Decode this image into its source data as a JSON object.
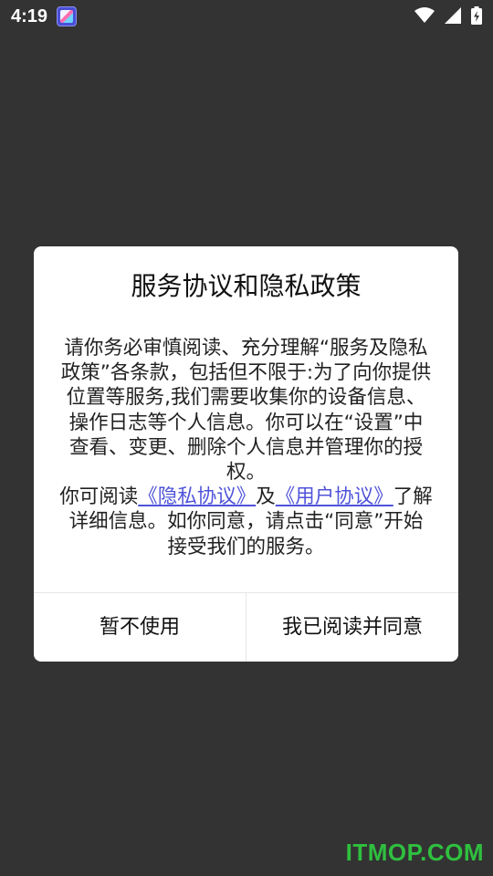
{
  "status_bar": {
    "time": "4:19",
    "notification_icon": "app-notification-icon",
    "icons": [
      "wifi-icon",
      "signal-icon",
      "battery-charging-icon"
    ]
  },
  "dialog": {
    "title": "服务协议和隐私政策",
    "paragraph1": "请你务必审慎阅读、充分理解“服务及隐私政策”各条款，包括但不限于:为了向你提供位置等服务,我们需要收集你的设备信息、操作日志等个人信息。你可以在“设置”中查看、变更、删除个人信息并管理你的授权。",
    "paragraph2_prefix": " 你可阅读",
    "privacy_link": "《隐私协议》",
    "conjunction": "及",
    "user_link": "《用户协议》",
    "paragraph2_suffix": "了解详细信息。如你同意，请点击“同意”开始接受我们的服务。",
    "cancel_button": "暂不使用",
    "agree_button": "我已阅读并同意"
  },
  "watermark": "ITMOP.COM",
  "colors": {
    "background": "#333333",
    "dialog": "#ffffff",
    "link": "#4f53d9",
    "watermark": "#2fbf3f"
  }
}
